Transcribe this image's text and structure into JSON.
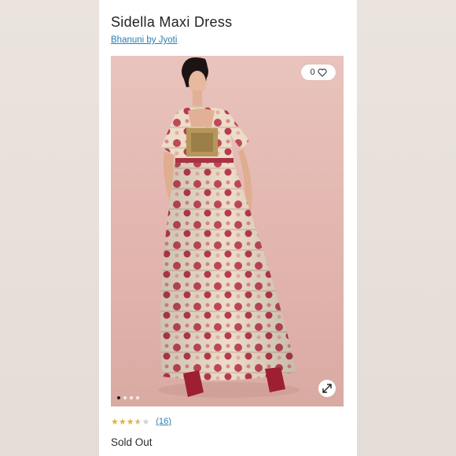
{
  "product": {
    "title": "Sidella Maxi Dress",
    "brand": "Bhanuni by Jyoti",
    "favorites_count": "0",
    "rating": 3.5,
    "rating_max": 5,
    "reviews_label": "(16)",
    "status": "Sold Out"
  },
  "gallery": {
    "image_count": 4,
    "active_index": 0
  },
  "icons": {
    "favorite": "heart-icon",
    "expand": "expand-arrows-icon",
    "star": "star-icon"
  },
  "colors": {
    "link": "#2a7fb4",
    "star_filled": "#e3b23c",
    "star_empty": "#d0d0d0",
    "background": "#ffffff"
  }
}
